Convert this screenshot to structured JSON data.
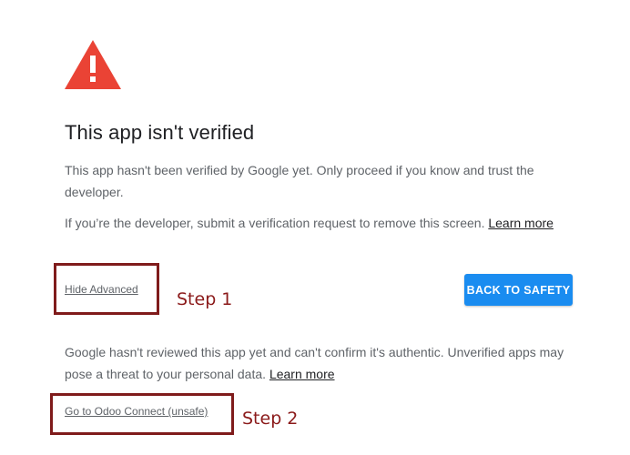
{
  "page": {
    "title": "This app isn't verified",
    "description": "This app hasn't been verified by Google yet. Only proceed if you know and trust the developer.",
    "developer_note": "If you’re the developer, submit a verification request to remove this screen.",
    "learn_more_label": "Learn more",
    "hide_advanced_label": "Hide Advanced",
    "back_to_safety_label": "BACK TO SAFETY",
    "advanced_note": "Google hasn't reviewed this app yet and can't confirm it's authentic. Unverified apps may pose a threat to your personal data.",
    "advanced_learn_more_label": "Learn more",
    "go_unsafe_label": "Go to Odoo Connect (unsafe)"
  },
  "annotations": {
    "step1_label": "Step 1",
    "step2_label": "Step 2",
    "box_color": "#7f1b1b",
    "text_color": "#8b1a1a"
  },
  "colors": {
    "warning_icon": "#ea4335",
    "button_bg": "#1a8cf0",
    "title_text": "#202124",
    "body_text": "#5f6368"
  },
  "icons": {
    "warning": "warning-triangle-icon"
  }
}
